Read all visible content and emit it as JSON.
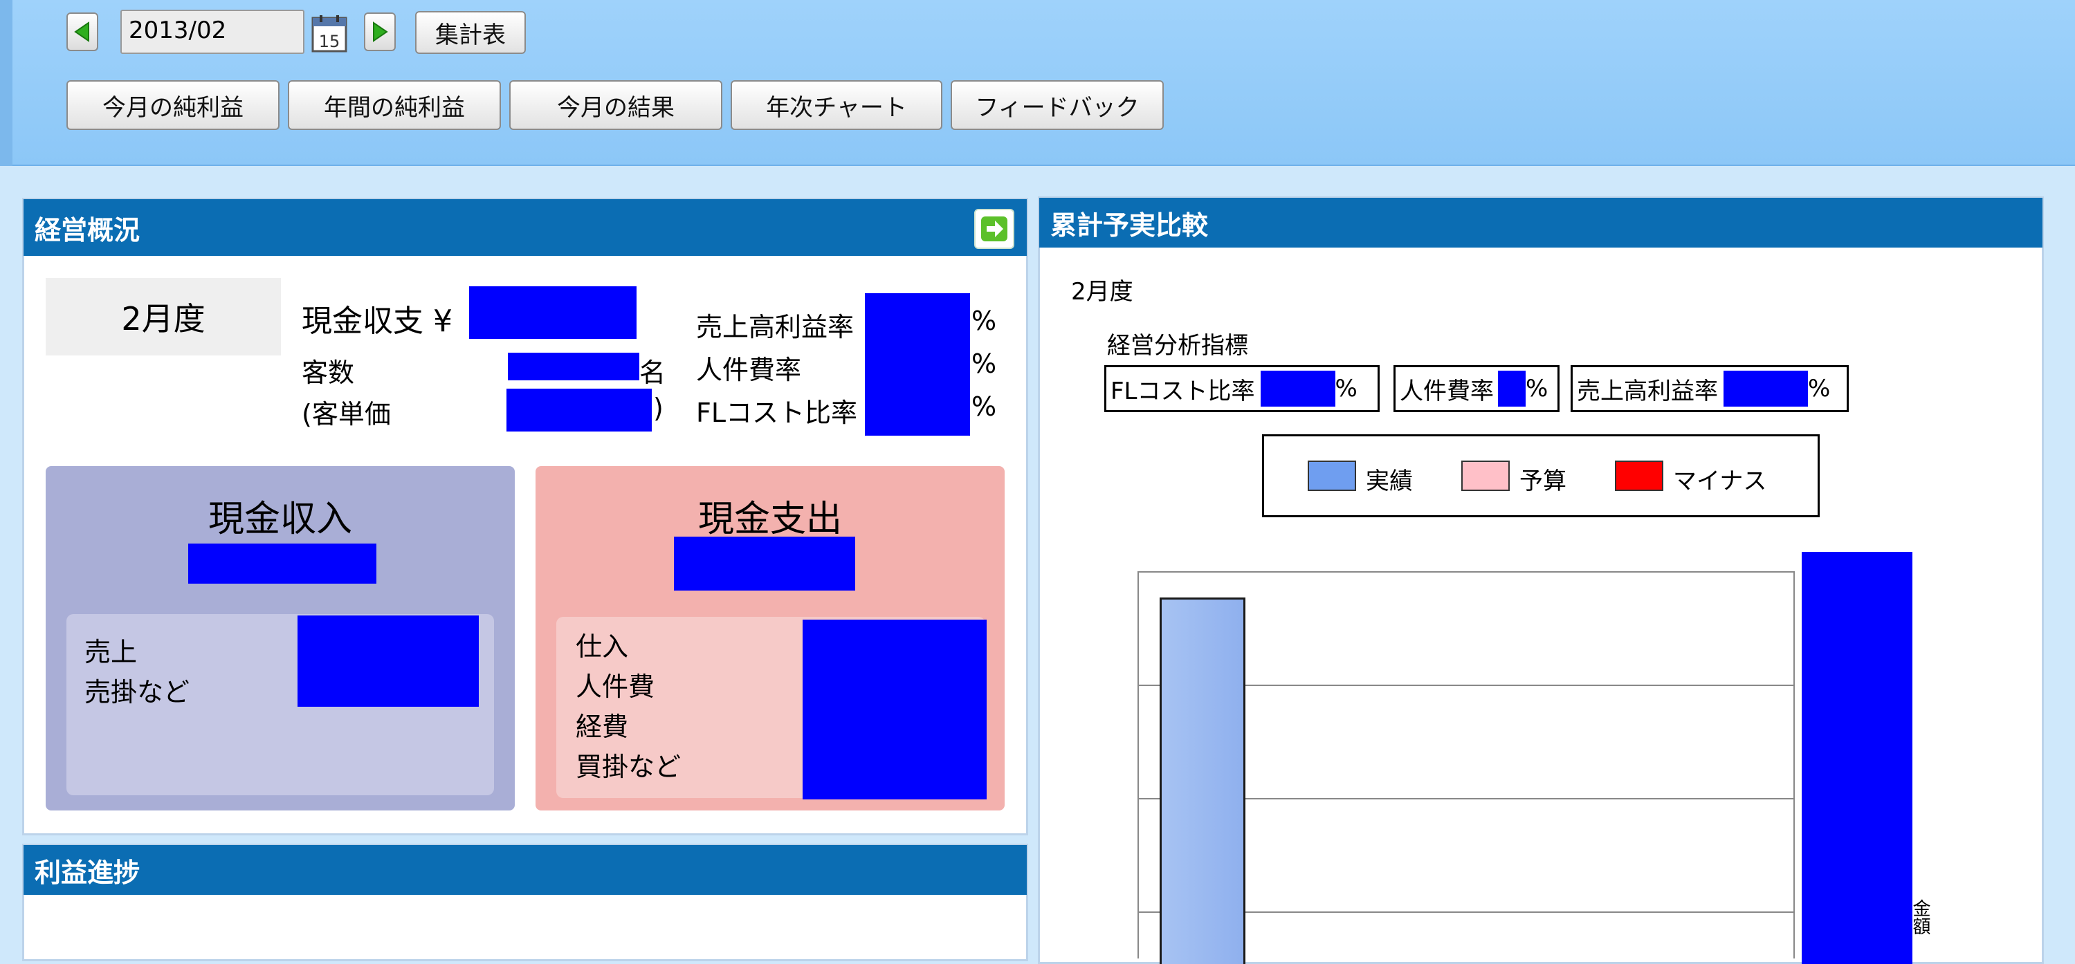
{
  "toolbar": {
    "date_value": "2013/02",
    "calendar_day": "15",
    "summary_button": "集計表",
    "tabs": [
      "今月の純利益",
      "年間の純利益",
      "今月の結果",
      "年次チャート",
      "フィードバック"
    ]
  },
  "overview": {
    "title": "経営概況",
    "month_label": "2月度",
    "cash_balance_label": "現金収支 ¥",
    "customers_label": "客数",
    "customers_unit": "名",
    "unit_price_label": "(客単価",
    "unit_price_close": ")",
    "sales_profit_rate_label": "売上高利益率",
    "labor_rate_label": "人件費率",
    "fl_cost_label": "FLコスト比率",
    "percent": "%",
    "income_title": "現金収入",
    "income_items": [
      "売上",
      "売掛など"
    ],
    "expense_title": "現金支出",
    "expense_items": [
      "仕入",
      "人件費",
      "経費",
      "買掛など"
    ]
  },
  "progress": {
    "title": "利益進捗"
  },
  "comparison": {
    "title": "累計予実比較",
    "month_label": "2月度",
    "indicators_title": "経営分析指標",
    "fl_label": "FLコスト比率",
    "labor_label": "人件費率",
    "profit_label": "売上高利益率",
    "percent": "%",
    "legend": [
      {
        "label": "実績",
        "color": "#6f9ef0"
      },
      {
        "label": "予算",
        "color": "#ffc0c8"
      },
      {
        "label": "マイナス",
        "color": "#ff0000"
      }
    ],
    "axis_cut_label": "金額"
  },
  "colors": {
    "header_blue": "#0b6db3",
    "redaction": "#0000ff",
    "income_bg": "#a9aed6",
    "expense_bg": "#f3b1ae"
  }
}
